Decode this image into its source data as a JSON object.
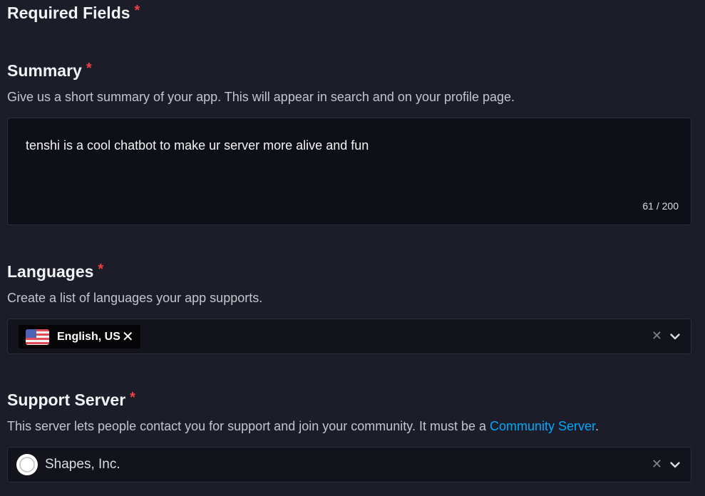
{
  "required_fields": {
    "heading": "Required Fields",
    "asterisk": "*"
  },
  "summary": {
    "heading": "Summary",
    "asterisk": "*",
    "description": "Give us a short summary of your app. This will appear in search and on your profile page.",
    "value": "tenshi is a cool chatbot to make ur server more alive and fun",
    "counter": "61 / 200"
  },
  "languages": {
    "heading": "Languages",
    "asterisk": "*",
    "description": "Create a list of languages your app supports.",
    "selected_tag": "English, US",
    "tag_remove": "✕",
    "clear": "✕",
    "flag_icon": "us-flag-icon"
  },
  "support_server": {
    "heading": "Support Server",
    "asterisk": "*",
    "description_prefix": "This server lets people contact you for support and join your community. It must be a ",
    "description_link": "Community Server",
    "description_suffix": ".",
    "selected_server": "Shapes, Inc.",
    "clear": "✕"
  },
  "colors": {
    "background": "#1c1d28",
    "input_bg": "#0f1017",
    "required": "#f23f43",
    "link": "#00a8fc"
  }
}
